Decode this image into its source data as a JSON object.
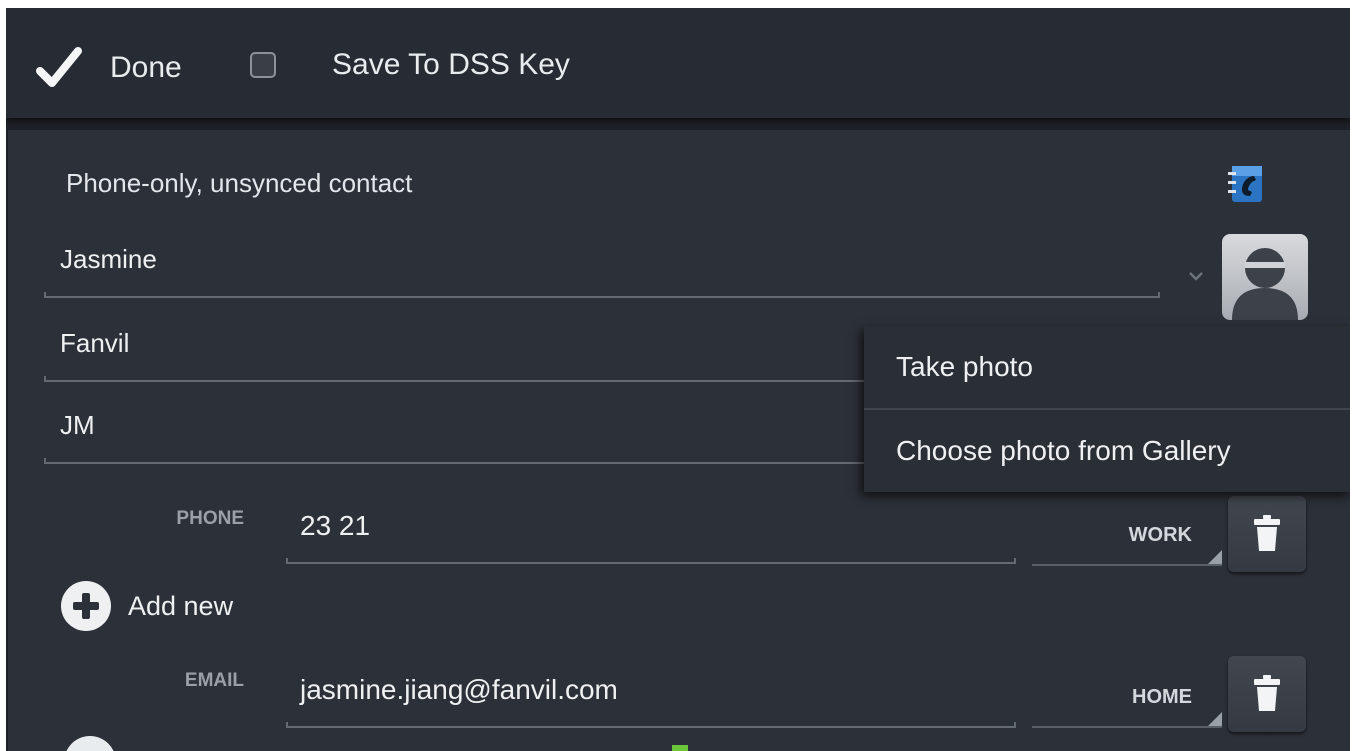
{
  "actionbar": {
    "done_label": "Done",
    "save_dss_label": "Save To DSS Key",
    "save_dss_checked": false
  },
  "account": {
    "label": "Phone-only, unsynced contact"
  },
  "fields": {
    "name": "Jasmine",
    "company": "Fanvil",
    "title": "JM"
  },
  "photo_menu": {
    "items": [
      "Take photo",
      "Choose photo from Gallery"
    ]
  },
  "phone": {
    "label": "PHONE",
    "value": "23 21",
    "type": "WORK"
  },
  "add_new": {
    "label": "Add new"
  },
  "email": {
    "label": "EMAIL",
    "value": "jasmine.jiang@fanvil.com",
    "type": "HOME"
  },
  "icons": {
    "done": "checkmark-icon",
    "contacts": "contacts-book-icon",
    "avatar": "person-silhouette-icon",
    "delete": "trash-icon",
    "add": "plus-circle-icon"
  }
}
